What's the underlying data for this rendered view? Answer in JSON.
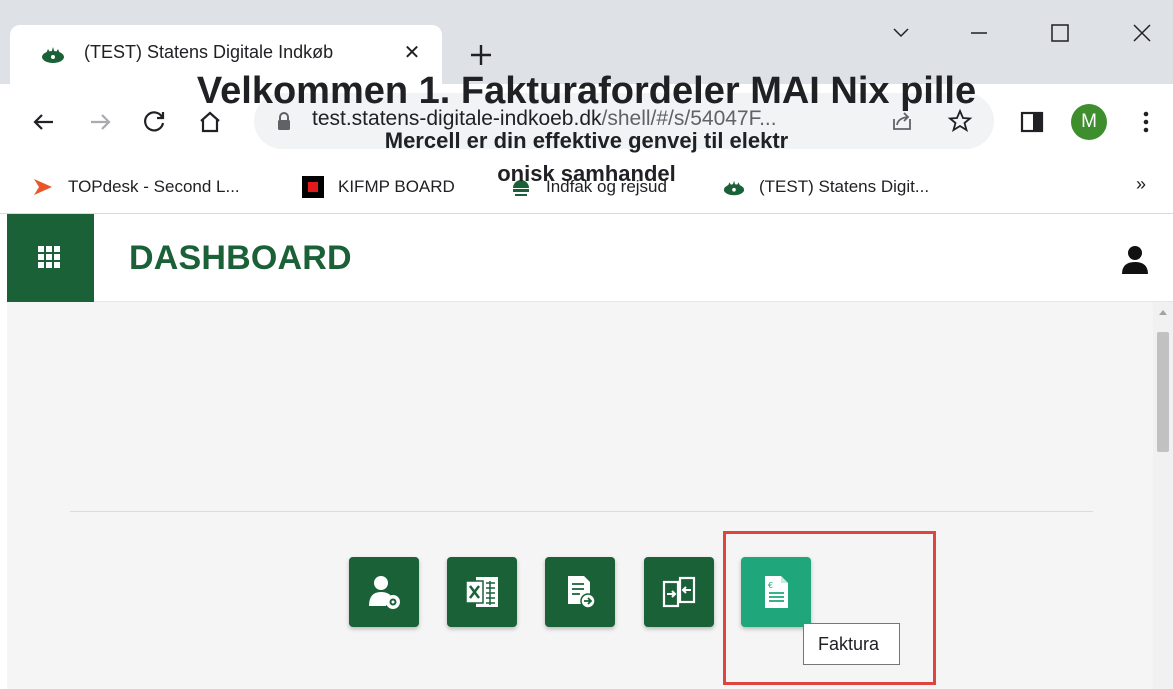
{
  "browser": {
    "tab": {
      "title": "(TEST) Statens Digitale Indkøb",
      "close": "✕"
    },
    "new_tab": "+",
    "window_controls": [
      "chevron-down-icon",
      "minimize-icon",
      "maximize-icon",
      "close-icon"
    ],
    "url": {
      "domain": "test.statens-digitale-indkoeb.dk",
      "path": "/shell/#/s/54047F..."
    },
    "profile_initial": "M",
    "profile_color": "#3e8e2e"
  },
  "bookmarks": {
    "items": [
      {
        "label": "TOPdesk - Second L...",
        "icon": "topdesk-icon"
      },
      {
        "label": "KIFMP BOARD",
        "icon": "kifmp-icon"
      },
      {
        "label": "Indfak og rejsud",
        "icon": "indfak-icon"
      },
      {
        "label": "(TEST) Statens Digit...",
        "icon": "crown-icon"
      }
    ],
    "more": "»"
  },
  "app": {
    "header_title": "DASHBOARD",
    "brand_color": "#1a6138",
    "welcome": "Velkommen 1. Fakturafordeler MAI Nix pille",
    "subtitle_line1": "Mercell er din effektive genvej til elektr",
    "subtitle_line2": "onisk samhandel",
    "tiles": [
      {
        "icon": "user-settings-icon"
      },
      {
        "icon": "excel-icon"
      },
      {
        "icon": "document-export-icon"
      },
      {
        "icon": "transfer-icon"
      },
      {
        "icon": "invoice-euro-icon",
        "active": true
      }
    ],
    "tooltip": "Faktura",
    "active_tile_color": "#1fa67a",
    "highlight_color": "#e0443e"
  }
}
